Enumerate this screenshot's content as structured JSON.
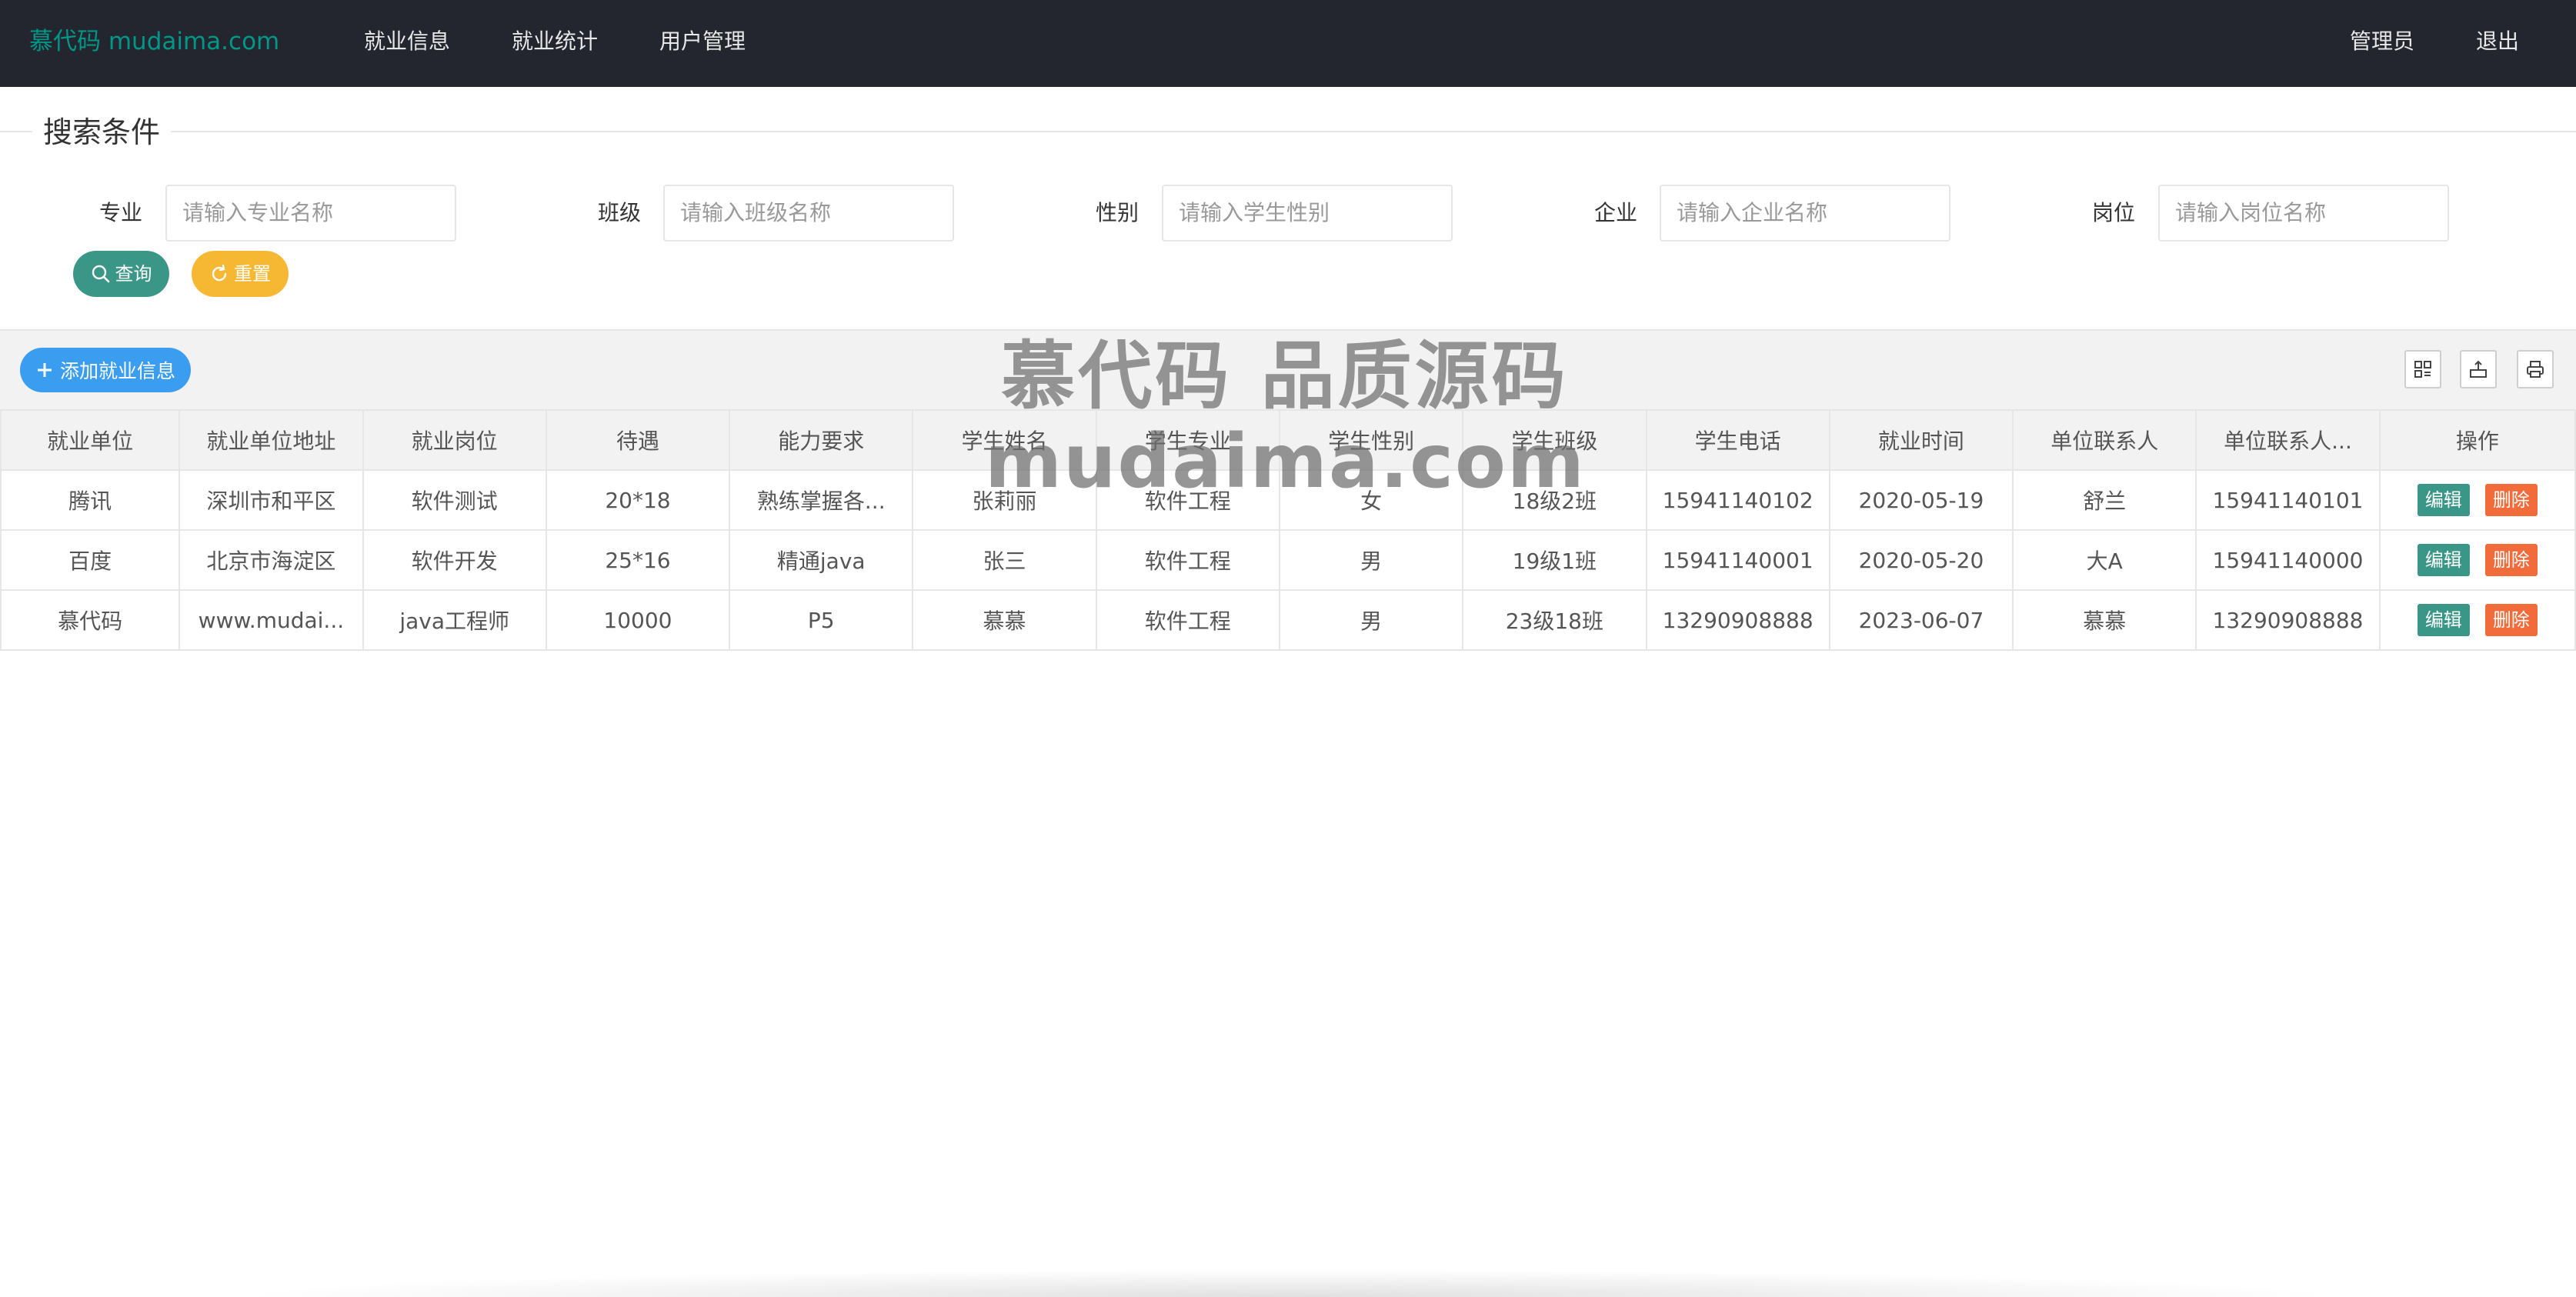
{
  "header": {
    "logo": "慕代码 mudaima.com",
    "nav": [
      "就业信息",
      "就业统计",
      "用户管理"
    ],
    "user": "管理员",
    "logout": "退出"
  },
  "search": {
    "legend": "搜索条件",
    "fields": [
      {
        "label": "专业",
        "placeholder": "请输入专业名称"
      },
      {
        "label": "班级",
        "placeholder": "请输入班级名称"
      },
      {
        "label": "性别",
        "placeholder": "请输入学生性别"
      },
      {
        "label": "企业",
        "placeholder": "请输入企业名称"
      },
      {
        "label": "岗位",
        "placeholder": "请输入岗位名称"
      }
    ],
    "search_label": "查询",
    "reset_label": "重置"
  },
  "toolbar": {
    "add_label": "添加就业信息",
    "icons": [
      "columns-filter-icon",
      "export-icon",
      "print-icon"
    ]
  },
  "table": {
    "headers": [
      "就业单位",
      "就业单位地址",
      "就业岗位",
      "待遇",
      "能力要求",
      "学生姓名",
      "学生专业",
      "学生性别",
      "学生班级",
      "学生电话",
      "就业时间",
      "单位联系人",
      "单位联系人...",
      "操作"
    ],
    "rows": [
      [
        "腾讯",
        "深圳市和平区",
        "软件测试",
        "20*18",
        "熟练掌握各...",
        "张莉丽",
        "软件工程",
        "女",
        "18级2班",
        "15941140102",
        "2020-05-19",
        "舒兰",
        "15941140101"
      ],
      [
        "百度",
        "北京市海淀区",
        "软件开发",
        "25*16",
        "精通java",
        "张三",
        "软件工程",
        "男",
        "19级1班",
        "15941140001",
        "2020-05-20",
        "大A",
        "15941140000"
      ],
      [
        "慕代码",
        "www.mudai...",
        "java工程师",
        "10000",
        "P5",
        "慕慕",
        "软件工程",
        "男",
        "23级18班",
        "13290908888",
        "2023-06-07",
        "慕慕",
        "13290908888"
      ]
    ],
    "edit_label": "编辑",
    "delete_label": "删除"
  },
  "watermark": {
    "line1": "慕代码 品质源码",
    "line2": "mudaima.com"
  },
  "colors": {
    "topbar": "#23262e",
    "brand": "#009688",
    "primary_blue": "#3b9df0",
    "reset_yellow": "#f6b733",
    "danger": "#f26b3a"
  }
}
